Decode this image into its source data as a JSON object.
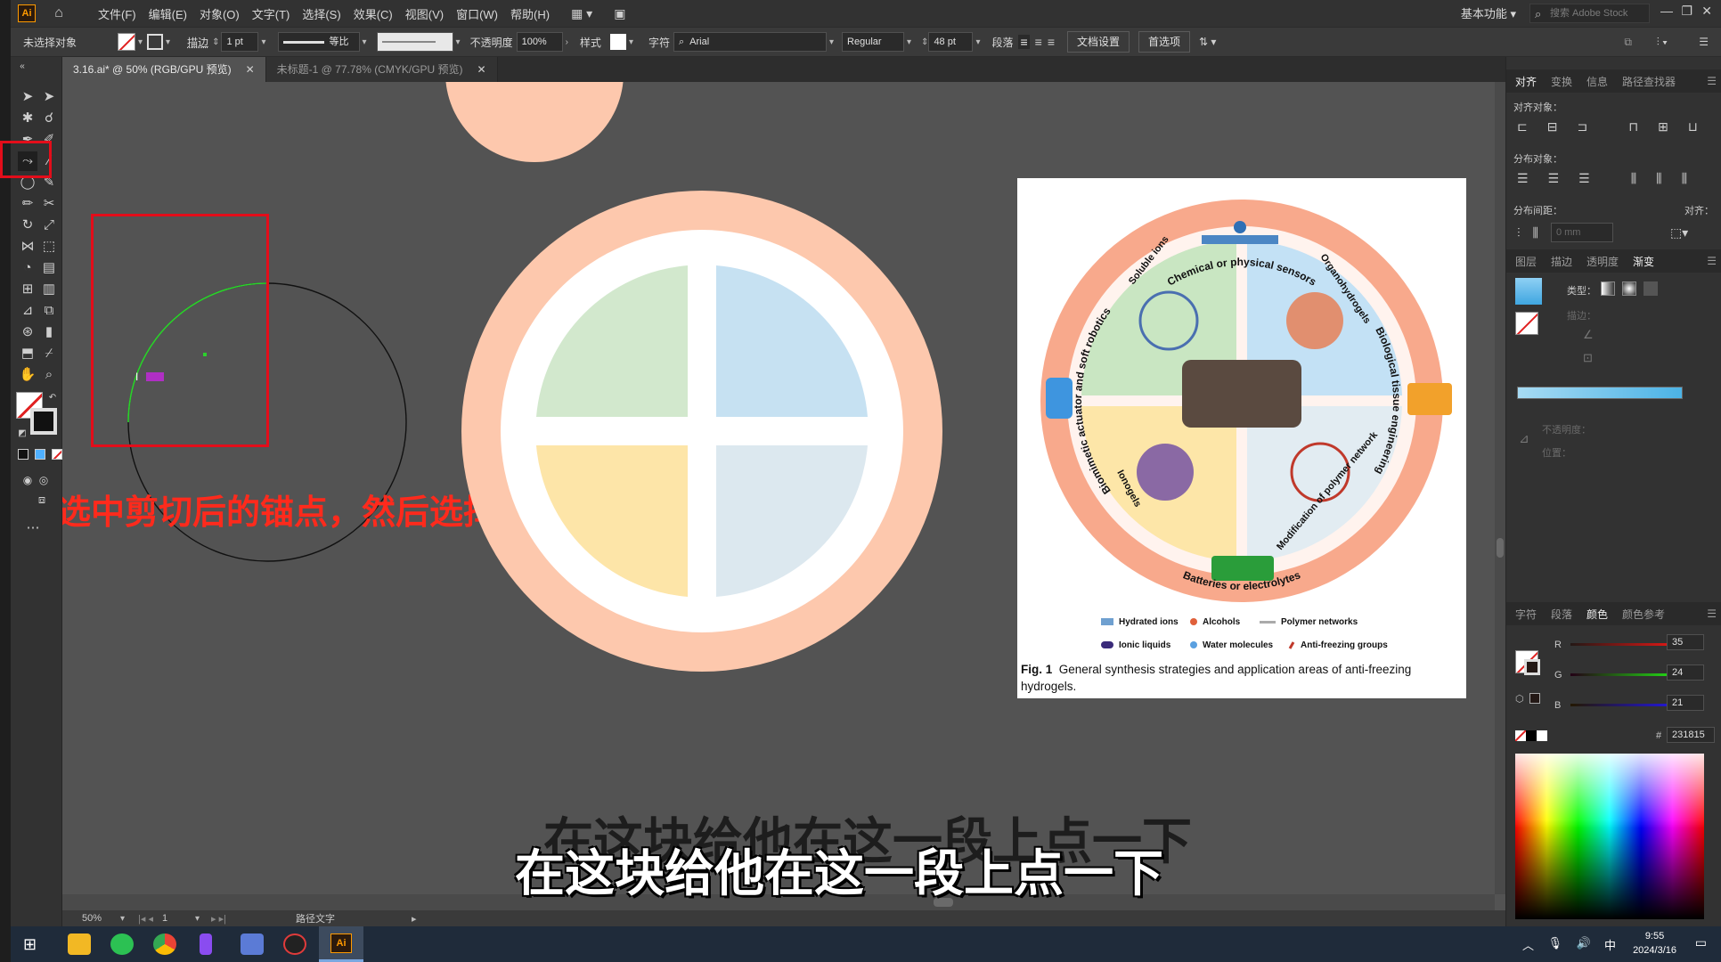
{
  "menubar": {
    "logo": "Ai",
    "items": [
      "文件(F)",
      "编辑(E)",
      "对象(O)",
      "文字(T)",
      "选择(S)",
      "效果(C)",
      "视图(V)",
      "窗口(W)",
      "帮助(H)"
    ],
    "workspace": "基本功能",
    "search_placeholder": "搜索 Adobe Stock"
  },
  "controlbar": {
    "selection_status": "未选择对象",
    "stroke_label": "描边",
    "stroke_value": "1 pt",
    "stroke_profile": "等比",
    "opacity_label": "不透明度",
    "opacity_value": "100%",
    "style_label": "样式",
    "char_label": "字符",
    "font_family": "Arial",
    "font_style": "Regular",
    "font_size": "48 pt",
    "paragraph_label": "段落",
    "doc_setup_button": "文档设置",
    "preferences_button": "首选项"
  },
  "tabs": [
    {
      "label": "3.16.ai* @ 50% (RGB/GPU 预览)",
      "active": true
    },
    {
      "label": "未标题-1 @ 77.78% (CMYK/GPU 预览)",
      "active": false
    }
  ],
  "canvas": {
    "annotation_text": "选中剪切后的锚点，然后选择路径文字工具",
    "subtitle_text": "在这块给他在这一段上点一下",
    "figure": {
      "labels": {
        "top": "Chemical or physical sensors",
        "right": "Biological tissue engineering",
        "bottom": "Batteries or electrolytes",
        "left": "Biomimetic actuator and soft robotics",
        "q1": "Soluble ions",
        "q2": "Organohydrogels",
        "q3": "Ionogels",
        "q4": "Modification of polymer network"
      },
      "legend": [
        "Hydrated ions",
        "Alcohols",
        "Polymer networks",
        "Ionic liquids",
        "Water molecules",
        "Anti-freezing groups"
      ],
      "caption_label": "Fig. 1",
      "caption_text": "General synthesis strategies and application areas of anti-freezing hydrogels."
    },
    "colors": {
      "ring": "#fdc8ad",
      "q_green": "#d2e8cd",
      "q_blue": "#c6e1f2",
      "q_yellow": "#fde5a8",
      "q_grey": "#dce8ef"
    }
  },
  "statusbar": {
    "zoom": "50%",
    "artboard": "1",
    "tool_name": "路径文字"
  },
  "rightpanel": {
    "top_tabs": [
      "对齐",
      "变换",
      "信息",
      "路径查找器"
    ],
    "align_objects_label": "对齐对象：",
    "distribute_objects_label": "分布对象：",
    "distribute_spacing_label": "分布间距：",
    "align_to_label": "对齐：",
    "spacing_value": "0 mm",
    "mid_tabs": [
      "图层",
      "描边",
      "透明度",
      "渐变"
    ],
    "gradient_type_label": "类型：",
    "gradient_stroke_label": "描边：",
    "opacity_label": "不透明度：",
    "position_label": "位置：",
    "color_tabs": [
      "字符",
      "段落",
      "颜色",
      "颜色参考"
    ],
    "color_values": {
      "R": "35",
      "G": "24",
      "B": "21",
      "hex": "231815"
    }
  },
  "taskbar": {
    "time": "9:55",
    "date": "2024/3/16",
    "ime": "中"
  }
}
